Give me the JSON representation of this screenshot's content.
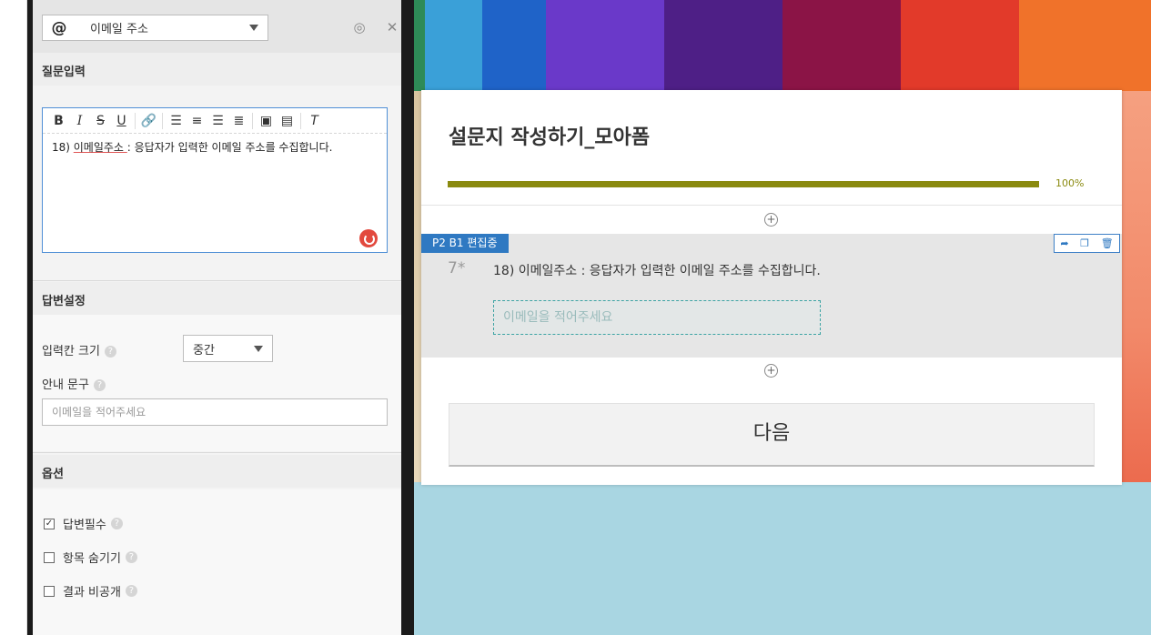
{
  "panel": {
    "type_select": {
      "icon": "at-icon",
      "label": "이메일 주소"
    },
    "question_section": {
      "title": "질문입력",
      "editor_text_prefix": "18) ",
      "editor_text_highlight": "이메일주소 ",
      "editor_text_rest": ": 응답자가 입력한 이메일 주소를 수집합니다."
    },
    "answer_section": {
      "title": "답변설정",
      "input_size_label": "입력칸 크기",
      "input_size_value": "중간",
      "guide_label": "안내 문구",
      "guide_placeholder": "이메일을 적어주세요"
    },
    "options_section": {
      "title": "옵션",
      "items": [
        {
          "label": "답변필수",
          "checked": true
        },
        {
          "label": "항목 숨기기",
          "checked": false
        },
        {
          "label": "결과 비공개",
          "checked": false
        }
      ]
    },
    "help_glyph": "?"
  },
  "survey": {
    "title": "설문지 작성하기_모아폼",
    "progress_label": "100%",
    "progress_value": 1.0,
    "edit_tag": "P2 B1 편집중",
    "question_number": "7*",
    "question_text": "18) 이메일주소 : 응답자가 입력한 이메일 주소를 수집합니다.",
    "answer_placeholder": "이메일을 적어주세요",
    "next_button": "다음"
  },
  "colors": {
    "accent_blue": "#2f79c2",
    "progress": "#8a8a0f"
  }
}
